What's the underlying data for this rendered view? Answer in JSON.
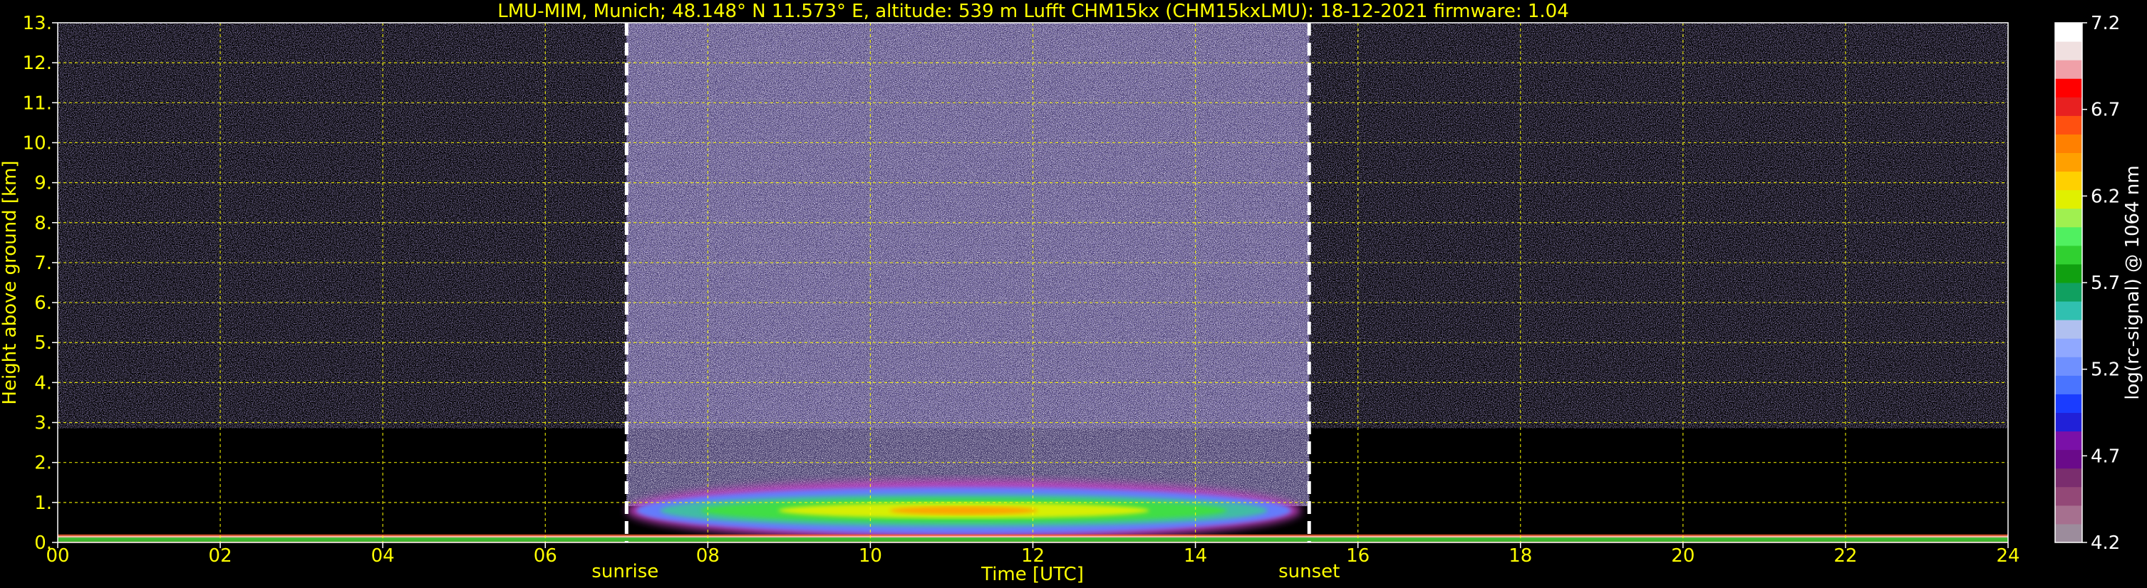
{
  "chart_data": {
    "type": "heatmap",
    "title": "LMU-MIM, Munich; 48.148° N 11.573° E, altitude: 539 m    Lufft CHM15kx (CHM15kxLMU): 18-12-2021    firmware: 1.04",
    "xlabel": "Time [UTC]",
    "ylabel": "Height above ground [km]",
    "xlim": [
      0,
      24
    ],
    "ylim": [
      0,
      13
    ],
    "x_ticks": [
      "00",
      "02",
      "04",
      "06",
      "08",
      "10",
      "12",
      "14",
      "16",
      "18",
      "20",
      "22",
      "24"
    ],
    "y_ticks": [
      "0.",
      "1.",
      "2.",
      "3.",
      "4.",
      "5.",
      "6.",
      "7.",
      "8.",
      "9.",
      "10.",
      "11.",
      "12.",
      "13."
    ],
    "grid": true,
    "sunrise_hour": 7.0,
    "sunset_hour": 15.4,
    "sunrise_label": "sunrise",
    "sunset_label": "sunset",
    "colorbar": {
      "label": "log(rc-signal) @ 1064 nm",
      "range": [
        4.2,
        7.2
      ],
      "ticks": [
        "4.2",
        "4.7",
        "5.2",
        "5.7",
        "6.2",
        "6.7",
        "7.2"
      ],
      "colors": [
        "#9c8c9c",
        "#a6708f",
        "#934877",
        "#7a2d6e",
        "#6a0a8a",
        "#7a10a8",
        "#2020d8",
        "#1a3cff",
        "#4a74ff",
        "#6f90ff",
        "#90a8ff",
        "#b0c0f0",
        "#30c0b0",
        "#10a060",
        "#10a010",
        "#30d030",
        "#50f060",
        "#a0f050",
        "#e0f000",
        "#ffd000",
        "#ffa000",
        "#ff8000",
        "#ff5010",
        "#e82020",
        "#ff0000",
        "#f0a0a8",
        "#f0e0e0",
        "#ffffff"
      ]
    },
    "noise_floor_color": "#6a58a0",
    "boundary_layer_cloud": {
      "x_range": [
        7.0,
        15.3
      ],
      "y_range": [
        0.45,
        1.95
      ],
      "core_y": 0.8,
      "peak_value": 6.1,
      "colors": [
        "#c040c0",
        "#6080ff",
        "#40c0a0",
        "#40e040",
        "#e0f000",
        "#ffa000"
      ]
    },
    "surface_layer": {
      "y_top": 0.2,
      "colors": [
        "#ff6030",
        "#ffd0c0",
        "#30c030"
      ]
    }
  }
}
